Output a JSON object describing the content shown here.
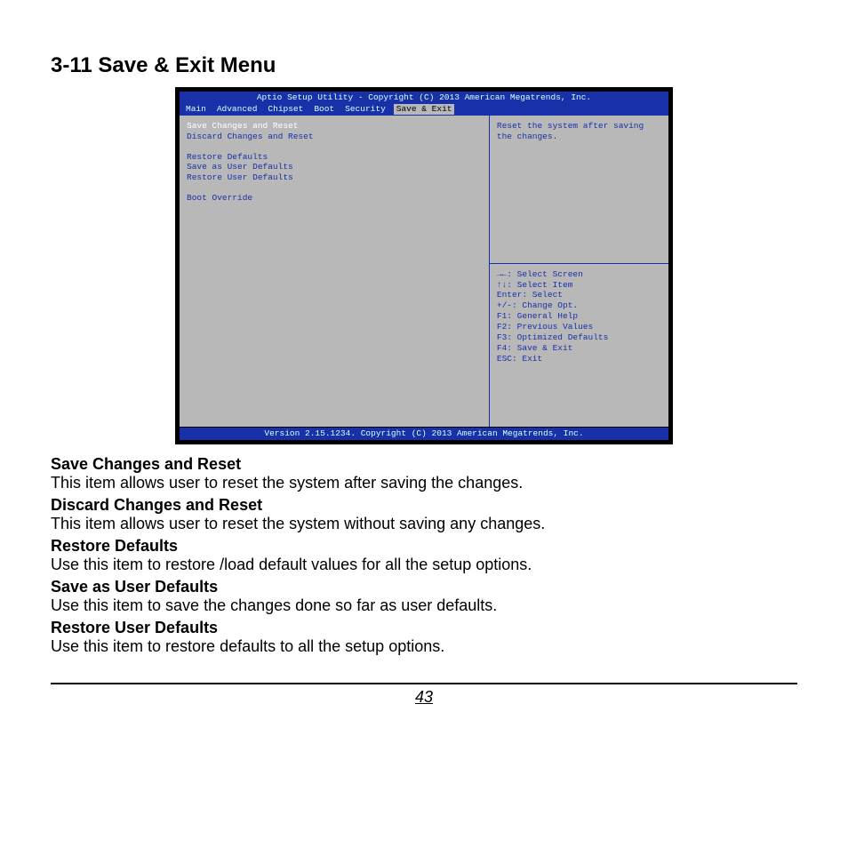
{
  "section_title": "3-11 Save & Exit Menu",
  "bios": {
    "header": "Aptio Setup Utility - Copyright (C) 2013 American Megatrends, Inc.",
    "tabs": {
      "main": "Main",
      "advanced": "Advanced",
      "chipset": "Chipset",
      "boot": "Boot",
      "security": "Security",
      "save_exit": "Save & Exit"
    },
    "left_items": {
      "save_changes_reset": "Save Changes and Reset",
      "discard_changes_reset": "Discard Changes and Reset",
      "restore_defaults": "Restore Defaults",
      "save_user_defaults": "Save as User Defaults",
      "restore_user_defaults": "Restore User Defaults",
      "boot_override": "Boot Override"
    },
    "help_text": "Reset the system after saving the changes.",
    "keys": {
      "select_screen": "→←: Select Screen",
      "select_item": "↑↓: Select Item",
      "enter": "Enter: Select",
      "change": "+/-: Change Opt.",
      "f1": "F1: General Help",
      "f2": "F2: Previous Values",
      "f3": "F3: Optimized Defaults",
      "f4": "F4: Save & Exit",
      "esc": "ESC: Exit"
    },
    "footer": "Version 2.15.1234. Copyright (C) 2013 American Megatrends, Inc."
  },
  "descriptions": [
    {
      "title": "Save Changes and Reset",
      "text": "This item allows user to reset the system after saving the changes."
    },
    {
      "title": "Discard Changes and Reset",
      "text": "This item allows user to reset the system without saving any changes."
    },
    {
      "title": "Restore Defaults",
      "text": "Use this item to restore /load default values for all the setup options."
    },
    {
      "title": "Save as User Defaults",
      "text": "Use this item to save the changes done so far as user defaults."
    },
    {
      "title": "Restore User Defaults",
      "text": "Use this item to restore defaults to all the setup options."
    }
  ],
  "page_number": "43"
}
